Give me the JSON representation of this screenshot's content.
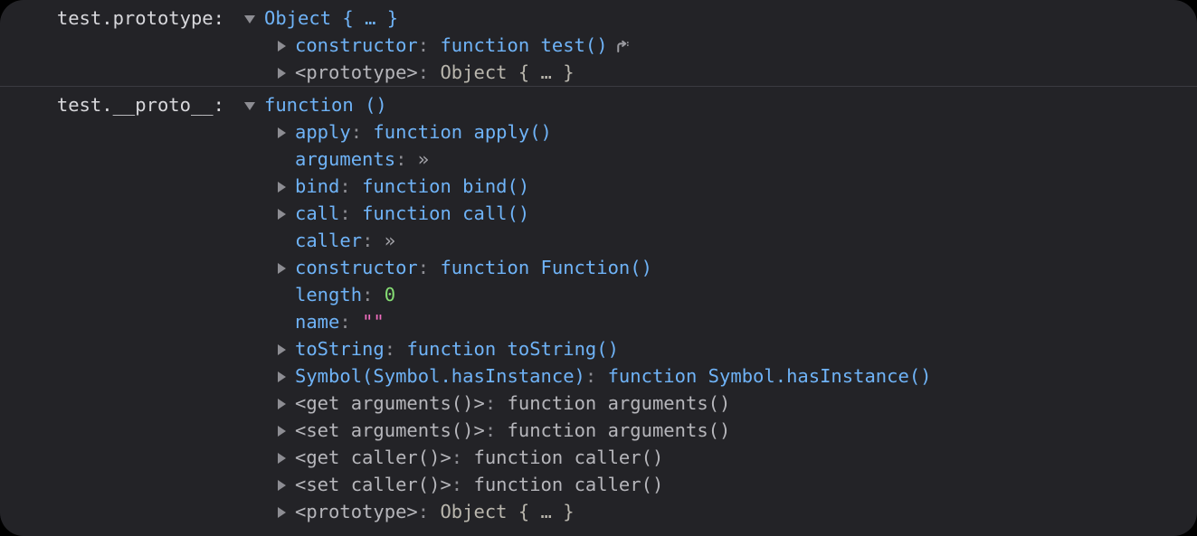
{
  "window": {
    "background_color": "#000000",
    "panel_color": "#232327",
    "divider_color": "#3b3b41",
    "corner_radius": "26px"
  },
  "colors": {
    "label": "#d8d8dc",
    "property_name": "#6fb3f7",
    "property_name_grey": "#b6b6bb",
    "colon": "#8d8d93",
    "function_value": "#6fb3f7",
    "function_value_grey": "#b6b6bb",
    "object_value": "#6fb3f7",
    "object_value_grey": "#b9b6ad",
    "number": "#86de74",
    "string": "#f06dbe",
    "twisty": "#8d8d93",
    "ellipsis": "#a2a2a8"
  },
  "messages": [
    {
      "label": "test.prototype:",
      "root": {
        "twisty": "down",
        "value": "Object { … }",
        "value_style": "object"
      },
      "children": [
        {
          "twisty": "right",
          "name": "constructor",
          "name_style": "blue",
          "value": "function test()",
          "value_style": "function",
          "jump_icon": "jump-to-definition-icon"
        },
        {
          "twisty": "right",
          "name": "<prototype>",
          "name_style": "grey",
          "value": "Object { … }",
          "value_style": "object-grey"
        }
      ]
    },
    {
      "label": "test.__proto__:",
      "root": {
        "twisty": "down",
        "value": "function ()",
        "value_style": "function"
      },
      "children": [
        {
          "twisty": "right",
          "name": "apply",
          "name_style": "blue",
          "value": "function apply()",
          "value_style": "function"
        },
        {
          "twisty": "none",
          "name": "arguments",
          "name_style": "blue",
          "value": "»",
          "value_style": "more"
        },
        {
          "twisty": "right",
          "name": "bind",
          "name_style": "blue",
          "value": "function bind()",
          "value_style": "function"
        },
        {
          "twisty": "right",
          "name": "call",
          "name_style": "blue",
          "value": "function call()",
          "value_style": "function"
        },
        {
          "twisty": "none",
          "name": "caller",
          "name_style": "blue",
          "value": "»",
          "value_style": "more"
        },
        {
          "twisty": "right",
          "name": "constructor",
          "name_style": "blue",
          "value": "function Function()",
          "value_style": "function"
        },
        {
          "twisty": "none",
          "name": "length",
          "name_style": "blue",
          "value": "0",
          "value_style": "number"
        },
        {
          "twisty": "none",
          "name": "name",
          "name_style": "blue",
          "value": "\"\"",
          "value_style": "string"
        },
        {
          "twisty": "right",
          "name": "toString",
          "name_style": "blue",
          "value": "function toString()",
          "value_style": "function"
        },
        {
          "twisty": "right",
          "name": "Symbol(Symbol.hasInstance)",
          "name_style": "blue",
          "value": "function Symbol.hasInstance()",
          "value_style": "function"
        },
        {
          "twisty": "right",
          "name": "<get arguments()>",
          "name_style": "grey",
          "value": "function arguments()",
          "value_style": "function-grey"
        },
        {
          "twisty": "right",
          "name": "<set arguments()>",
          "name_style": "grey",
          "value": "function arguments()",
          "value_style": "function-grey"
        },
        {
          "twisty": "right",
          "name": "<get caller()>",
          "name_style": "grey",
          "value": "function caller()",
          "value_style": "function-grey"
        },
        {
          "twisty": "right",
          "name": "<set caller()>",
          "name_style": "grey",
          "value": "function caller()",
          "value_style": "function-grey"
        },
        {
          "twisty": "right",
          "name": "<prototype>",
          "name_style": "grey",
          "value": "Object { … }",
          "value_style": "object-grey"
        }
      ]
    }
  ]
}
